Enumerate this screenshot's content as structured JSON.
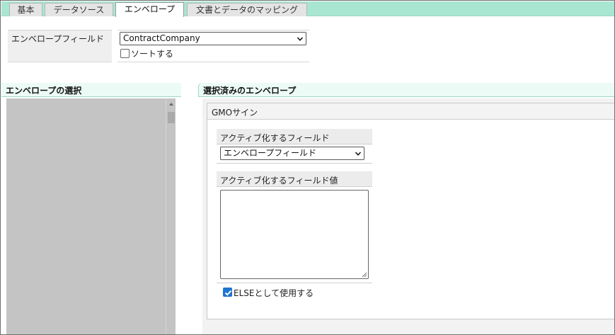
{
  "tabs": [
    {
      "label": "基本",
      "active": false
    },
    {
      "label": "データソース",
      "active": false
    },
    {
      "label": "エンベロープ",
      "active": true
    },
    {
      "label": "文書とデータのマッピング",
      "active": false
    }
  ],
  "envelope_field": {
    "label": "エンベロープフィールド",
    "selected": "ContractCompany",
    "sort_label": "ソートする",
    "sort_checked": false
  },
  "left_section": {
    "title": "エンベロープの選択"
  },
  "right_section": {
    "title": "選択済みのエンベロープ",
    "envelope": {
      "name": "GMOサイン",
      "activate_field_label": "アクティブ化するフィールド",
      "activate_field_selected": "エンベロープフィールド",
      "activate_value_label": "アクティブ化するフィールド値",
      "activate_value": "",
      "else_label": "ELSEとして使用する",
      "else_checked": true
    }
  },
  "colors": {
    "accent": "#a8e6d2",
    "list_bg": "#c4c4c4",
    "checkbox_blue": "#1e74d0"
  }
}
